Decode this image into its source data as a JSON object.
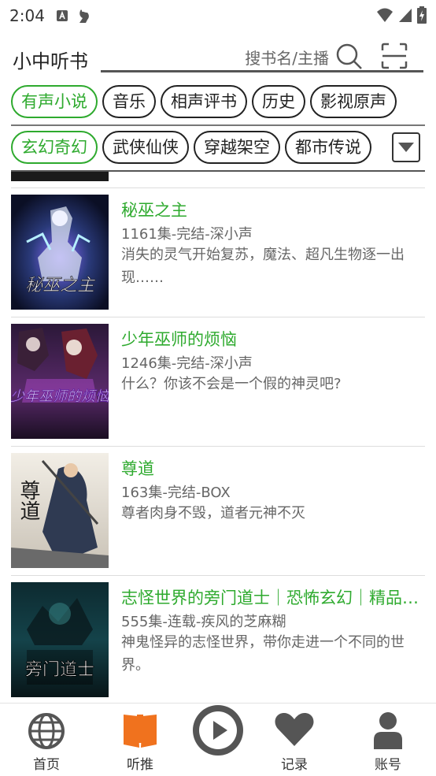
{
  "status_bar": {
    "time": "2:04",
    "icons": [
      "notification-a-icon",
      "bird-icon",
      "wifi-icon",
      "signal-icon",
      "battery-icon"
    ]
  },
  "header": {
    "title": "小中听书",
    "search_placeholder": "搜书名/主播"
  },
  "categories": [
    {
      "label": "有声小说",
      "active": true
    },
    {
      "label": "音乐",
      "active": false
    },
    {
      "label": "相声评书",
      "active": false
    },
    {
      "label": "历史",
      "active": false
    },
    {
      "label": "影视原声",
      "active": false
    }
  ],
  "subcategories": [
    {
      "label": "玄幻奇幻",
      "active": true
    },
    {
      "label": "武侠仙侠",
      "active": false
    },
    {
      "label": "穿越架空",
      "active": false
    },
    {
      "label": "都市传说",
      "active": false
    }
  ],
  "books": [
    {
      "title": "秘巫之主",
      "meta": "1161集-完结-深小声",
      "desc": "消失的灵气开始复苏，魔法、超凡生物逐一出现……",
      "cover_text": "秘巫之主"
    },
    {
      "title": "少年巫师的烦恼",
      "meta": "1246集-完结-深小声",
      "desc": "什么？你该不会是一个假的神灵吧?",
      "cover_text": "少年巫师的烦恼"
    },
    {
      "title": "尊道",
      "meta": "163集-完结-BOX",
      "desc": "尊者肉身不毁，道者元神不灭",
      "cover_text": "尊道"
    },
    {
      "title": "志怪世界的旁门道士｜恐怖玄幻｜精品多人有声剧",
      "meta": "555集-连载-疾风的芝麻糊",
      "desc": "神鬼怪异的志怪世界，带你走进一个不同的世界。",
      "cover_text": "旁门道士"
    }
  ],
  "bottom_nav": [
    {
      "label": "首页",
      "icon": "globe-icon"
    },
    {
      "label": "听推",
      "icon": "book-open-icon"
    },
    {
      "label": "",
      "icon": "play-icon"
    },
    {
      "label": "记录",
      "icon": "heart-icon"
    },
    {
      "label": "账号",
      "icon": "person-icon"
    }
  ],
  "colors": {
    "accent_green": "#2eaa2e",
    "nav_active_orange": "#f0721e",
    "nav_icon_gray": "#555555"
  }
}
